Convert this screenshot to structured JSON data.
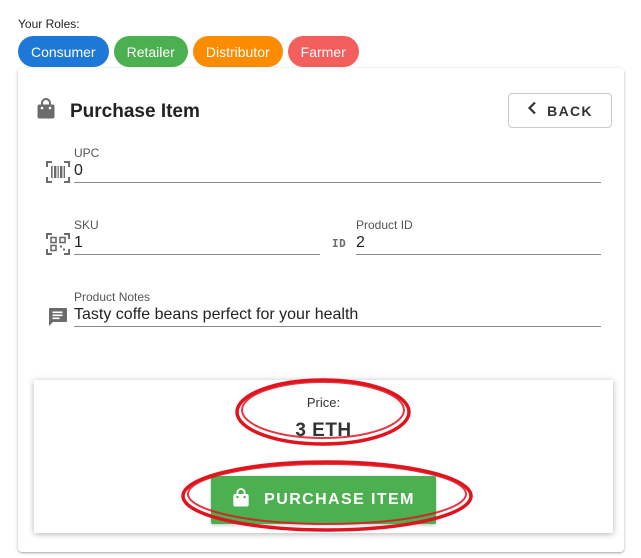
{
  "roles_label": "Your Roles:",
  "roles": [
    {
      "label": "Consumer",
      "color": "#1e78d7"
    },
    {
      "label": "Retailer",
      "color": "#4caf50"
    },
    {
      "label": "Distributor",
      "color": "#fb8c00"
    },
    {
      "label": "Farmer",
      "color": "#f25f5c"
    }
  ],
  "card": {
    "title": "Purchase Item",
    "back_label": "BACK"
  },
  "fields": {
    "upc": {
      "label": "UPC",
      "value": "0"
    },
    "sku": {
      "label": "SKU",
      "value": "1"
    },
    "product_id": {
      "label": "Product ID",
      "value": "2",
      "icon_text": "ID"
    },
    "product_notes": {
      "label": "Product Notes",
      "value": "Tasty coffe beans perfect for your health"
    }
  },
  "price": {
    "label": "Price:",
    "value": "3 ETH"
  },
  "purchase_label": "PURCHASE ITEM",
  "colors": {
    "accent_green": "#4caf50",
    "annotation_red": "#e0141e",
    "icon_gray": "#6b6b6b"
  }
}
